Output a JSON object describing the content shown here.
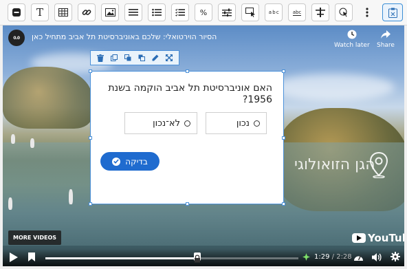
{
  "toolbar": {
    "items": [
      {
        "name": "minus-box-icon"
      },
      {
        "name": "text-icon",
        "glyph": "T"
      },
      {
        "name": "table-icon"
      },
      {
        "name": "link-icon"
      },
      {
        "name": "image-icon"
      },
      {
        "name": "bulleted-list-icon"
      },
      {
        "name": "numbered-list-icon"
      },
      {
        "name": "checklist-icon"
      },
      {
        "name": "percent-icon",
        "glyph": "%"
      },
      {
        "name": "sliders-icon"
      },
      {
        "name": "tooltip-icon"
      },
      {
        "name": "drag-text-icon",
        "glyph": "a b c"
      },
      {
        "name": "fill-blank-icon",
        "glyph": "abc"
      },
      {
        "name": "divider-icon"
      },
      {
        "name": "hotspot-icon"
      },
      {
        "name": "more-vertical-icon"
      },
      {
        "name": "paste-icon"
      }
    ]
  },
  "video": {
    "title": "הסיור הוירטואלי: שלכם באוניברסיטת תל אביב מתחיל כאן",
    "channel_logo": "0.0",
    "watch_later": "Watch later",
    "share": "Share",
    "watermark": "הגן הזואולוגי",
    "more_videos": "MORE VIDEOS",
    "youtube": "YouTube",
    "current_time": "1:29",
    "separator": " / ",
    "duration": "2:28",
    "progress": 0.601,
    "marker_progress": 0.601
  },
  "quiz": {
    "question": "האם אוניברסיטת תל אביב הוקמה בשנת 1956?",
    "answers": [
      {
        "label": "נכון"
      },
      {
        "label": "לא־נכון"
      }
    ],
    "check_label": "בדיקה"
  },
  "colors": {
    "accent": "#1f6bcf",
    "selection": "#4a90d9"
  }
}
